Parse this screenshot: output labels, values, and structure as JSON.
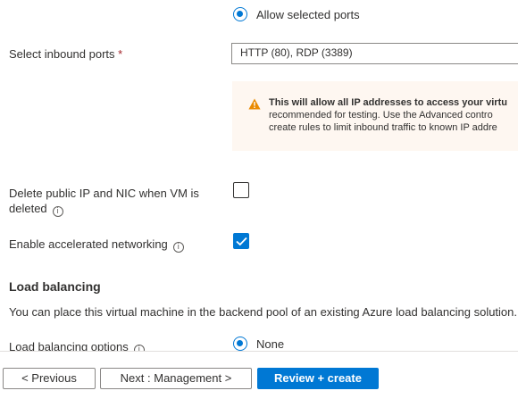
{
  "inbound": {
    "allow_selected_label": "Allow selected ports",
    "select_label": "Select inbound ports",
    "required_mark": "*",
    "select_value": "HTTP (80), RDP (3389)"
  },
  "warning": {
    "bold_text": "This will allow all IP addresses to access your virtu",
    "line2": "recommended for testing.  Use the Advanced contro",
    "line3": "create rules to limit inbound traffic to known IP addre",
    "color": "#ea8a00"
  },
  "options": {
    "delete_ip_label_line1": "Delete public IP and NIC when VM is",
    "delete_ip_label_line2": "deleted",
    "delete_ip_checked": false,
    "accel_label": "Enable accelerated networking",
    "accel_checked": true
  },
  "load_balancing": {
    "title": "Load balancing",
    "description": "You can place this virtual machine in the backend pool of an existing Azure load balancing solution.",
    "options_label": "Load balancing options",
    "none_label": "None"
  },
  "footer": {
    "previous": "< Previous",
    "next": "Next : Management >",
    "review": "Review + create"
  },
  "icons": {
    "info": "i"
  },
  "colors": {
    "accent": "#0078d4"
  }
}
